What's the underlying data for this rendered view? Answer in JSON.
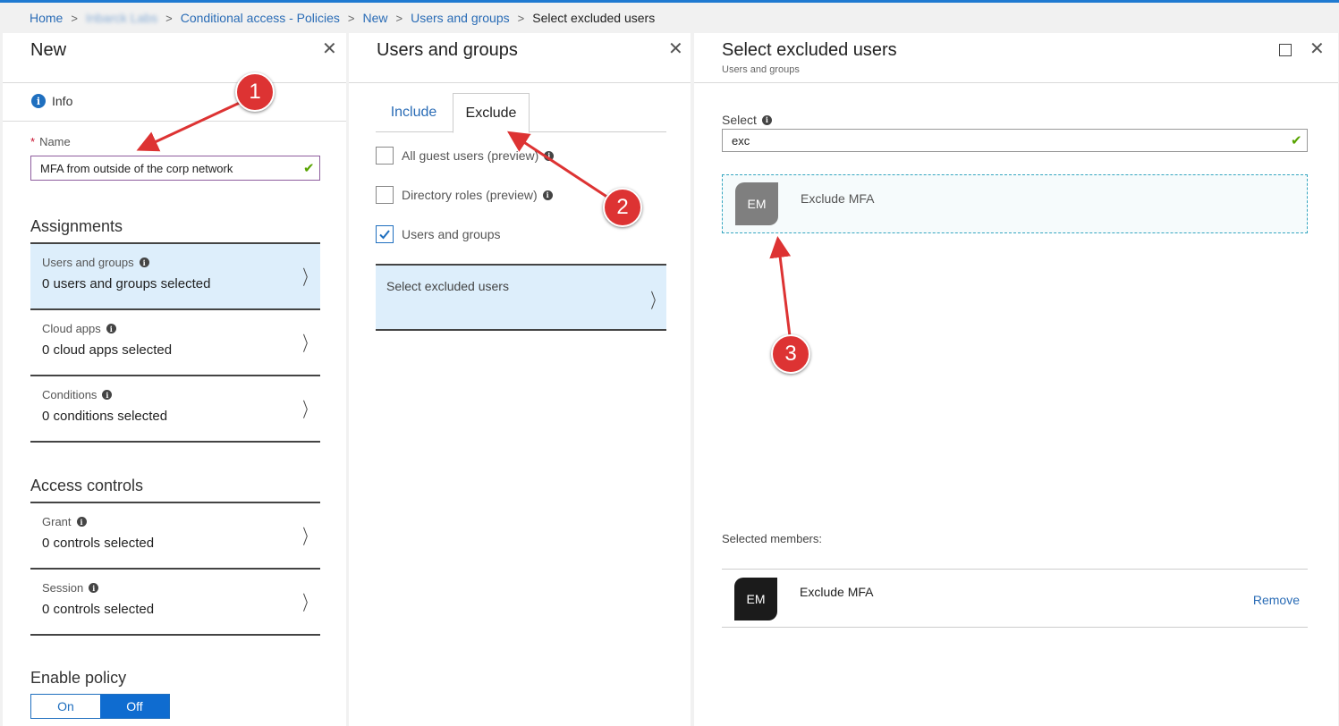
{
  "breadcrumb": {
    "home": "Home",
    "tenant": "Inbarck Labs",
    "policies": "Conditional access - Policies",
    "new": "New",
    "users_groups": "Users and groups",
    "current": "Select excluded users",
    "separator": ">"
  },
  "blade_new": {
    "title": "New",
    "info_label": "Info",
    "name_label": "Name",
    "required_marker": "*",
    "name_value": "MFA from outside of the corp network",
    "assignments_title": "Assignments",
    "assignments": [
      {
        "label": "Users and groups",
        "value": "0 users and groups selected"
      },
      {
        "label": "Cloud apps",
        "value": "0 cloud apps selected"
      },
      {
        "label": "Conditions",
        "value": "0 conditions selected"
      }
    ],
    "access_controls_title": "Access controls",
    "access_controls": [
      {
        "label": "Grant",
        "value": "0 controls selected"
      },
      {
        "label": "Session",
        "value": "0 controls selected"
      }
    ],
    "enable_policy_title": "Enable policy",
    "toggle_on": "On",
    "toggle_off": "Off",
    "toggle_selected": "Off"
  },
  "blade_users_groups": {
    "title": "Users and groups",
    "tabs": [
      "Include",
      "Exclude"
    ],
    "active_tab": "Exclude",
    "checkboxes": [
      {
        "label": "All guest users (preview)",
        "checked": false
      },
      {
        "label": "Directory roles (preview)",
        "checked": false
      },
      {
        "label": "Users and groups",
        "checked": true
      }
    ],
    "select_excluded_label": "Select excluded users"
  },
  "blade_select": {
    "title": "Select excluded users",
    "subtitle": "Users and groups",
    "select_label": "Select",
    "search_value": "exc",
    "result": {
      "initials": "EM",
      "name": "Exclude MFA"
    },
    "selected_members_title": "Selected members:",
    "members": [
      {
        "initials": "EM",
        "name": "Exclude MFA",
        "action": "Remove"
      }
    ]
  },
  "annotations": {
    "badges": [
      "1",
      "2",
      "3"
    ],
    "color": "#dd3333"
  },
  "colors": {
    "accent": "#1f6fbf",
    "link": "#2a6cb6",
    "active_bg": "#ddeefb",
    "success": "#57a300"
  },
  "icons": {
    "info": "info-icon",
    "close": "close-icon",
    "chevron": "chevron-right-icon",
    "check": "checkmark-icon",
    "maximize": "maximize-icon"
  }
}
